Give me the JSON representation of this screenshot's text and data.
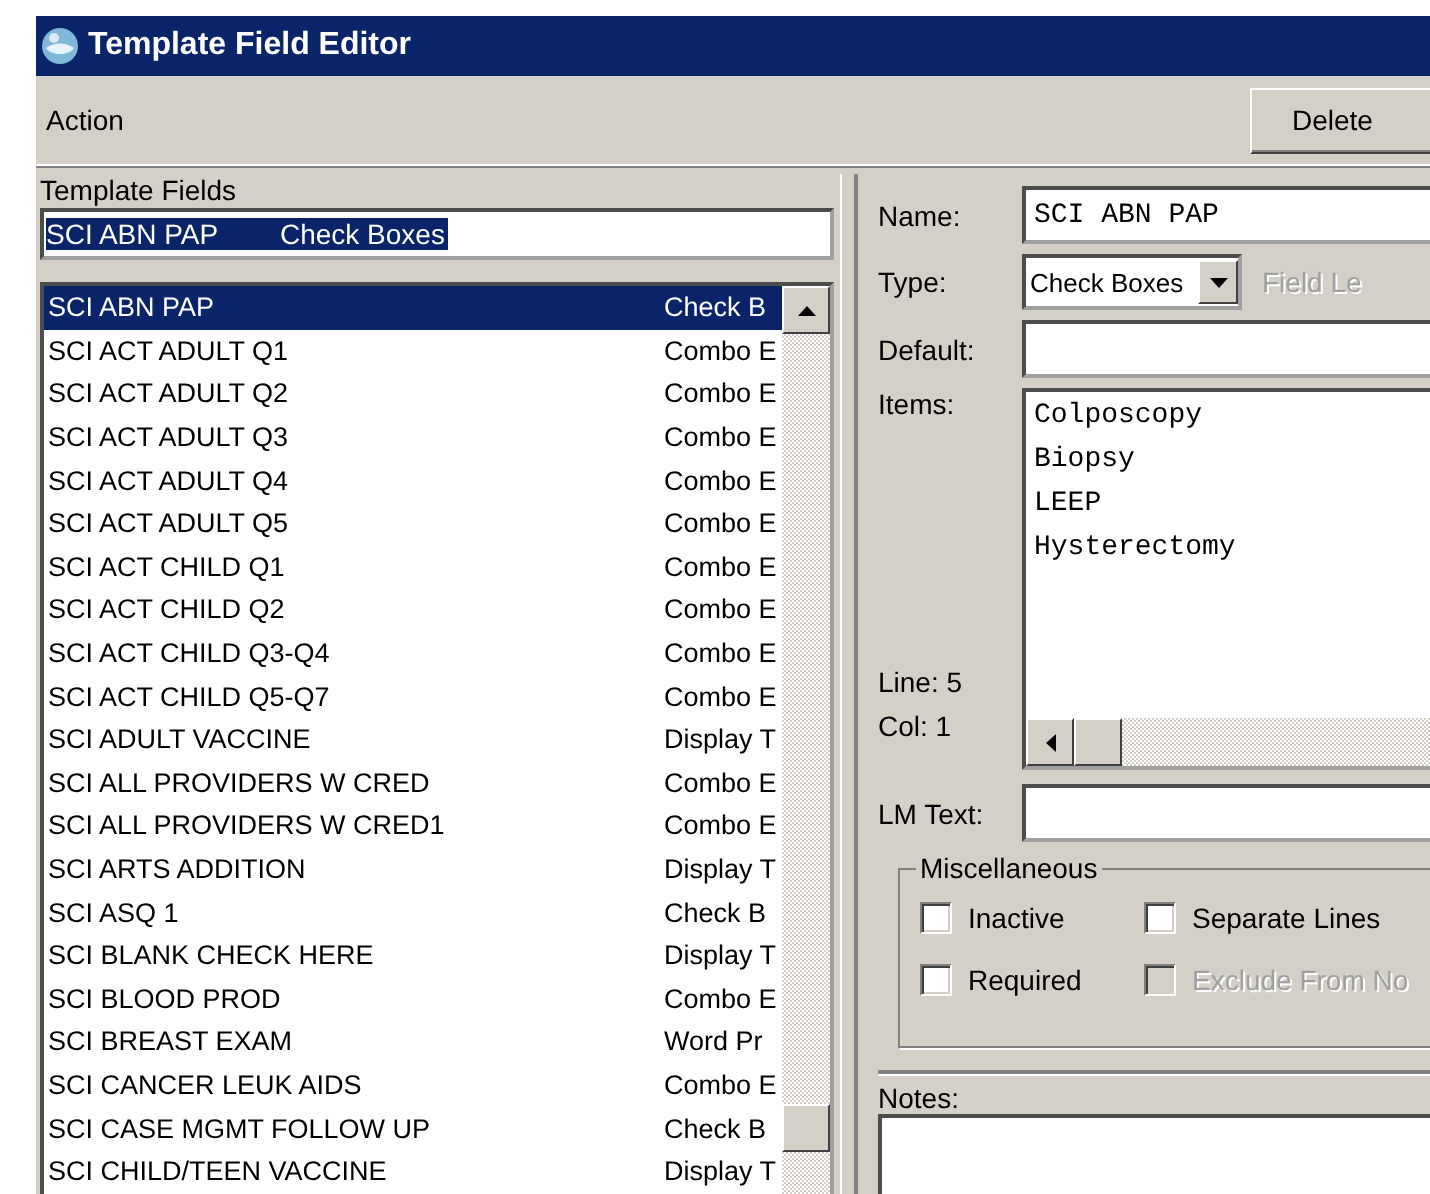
{
  "window": {
    "title": "Template Field Editor"
  },
  "menu": [
    {
      "label": "Action"
    }
  ],
  "toolbar": {
    "buttons": [
      "Delete"
    ]
  },
  "template_fields": {
    "label": "Template Fields",
    "filter": {
      "name": "SCI ABN PAP",
      "type": "Check Boxes",
      "selected": true
    },
    "rows": [
      {
        "name": "SCI ABN PAP",
        "type": "Check B",
        "selected": true
      },
      {
        "name": "SCI ACT ADULT Q1",
        "type": "Combo E",
        "selected": false
      },
      {
        "name": "SCI ACT ADULT Q2",
        "type": "Combo E",
        "selected": false
      },
      {
        "name": "SCI ACT ADULT Q3",
        "type": "Combo E",
        "selected": false
      },
      {
        "name": "SCI ACT ADULT Q4",
        "type": "Combo E",
        "selected": false
      },
      {
        "name": "SCI ACT ADULT Q5",
        "type": "Combo E",
        "selected": false
      },
      {
        "name": "SCI ACT CHILD Q1",
        "type": "Combo E",
        "selected": false
      },
      {
        "name": "SCI ACT CHILD Q2",
        "type": "Combo E",
        "selected": false
      },
      {
        "name": "SCI ACT CHILD Q3-Q4",
        "type": "Combo E",
        "selected": false
      },
      {
        "name": "SCI ACT CHILD Q5-Q7",
        "type": "Combo E",
        "selected": false
      },
      {
        "name": "SCI ADULT VACCINE",
        "type": "Display T",
        "selected": false
      },
      {
        "name": "SCI ALL PROVIDERS W CRED",
        "type": "Combo E",
        "selected": false
      },
      {
        "name": "SCI ALL PROVIDERS W CRED1",
        "type": "Combo E",
        "selected": false
      },
      {
        "name": "SCI ARTS ADDITION",
        "type": "Display T",
        "selected": false
      },
      {
        "name": "SCI ASQ 1",
        "type": "Check B",
        "selected": false
      },
      {
        "name": "SCI BLANK CHECK HERE",
        "type": "Display T",
        "selected": false
      },
      {
        "name": "SCI BLOOD PROD",
        "type": "Combo E",
        "selected": false
      },
      {
        "name": "SCI BREAST EXAM",
        "type": "Word Pr",
        "selected": false
      },
      {
        "name": "SCI CANCER LEUK AIDS",
        "type": "Combo E",
        "selected": false
      },
      {
        "name": "SCI CASE MGMT FOLLOW UP",
        "type": "Check B",
        "selected": false
      },
      {
        "name": "SCI CHILD/TEEN VACCINE",
        "type": "Display T",
        "selected": false
      }
    ]
  },
  "editor": {
    "name_label": "Name:",
    "name": "SCI ABN PAP",
    "type_label": "Type:",
    "type": "Check Boxes",
    "field_length": {
      "label": "Field Le",
      "disabled": true
    },
    "default_label": "Default:",
    "items_label": "Items:",
    "items": [
      "Colposcopy",
      "Biopsy",
      "LEEP",
      "Hysterectomy"
    ],
    "line": "Line: 5",
    "col": "Col: 1",
    "lm_text_label": "LM Text:",
    "misc": {
      "title": "Miscellaneous",
      "options": [
        {
          "label": "Inactive",
          "checked": false,
          "disabled": false
        },
        {
          "label": "Separate Lines",
          "checked": false,
          "disabled": false
        },
        {
          "label": "Required",
          "checked": false,
          "disabled": false
        },
        {
          "label": "Exclude From No",
          "checked": false,
          "disabled": true
        }
      ]
    },
    "notes_label": "Notes:"
  }
}
